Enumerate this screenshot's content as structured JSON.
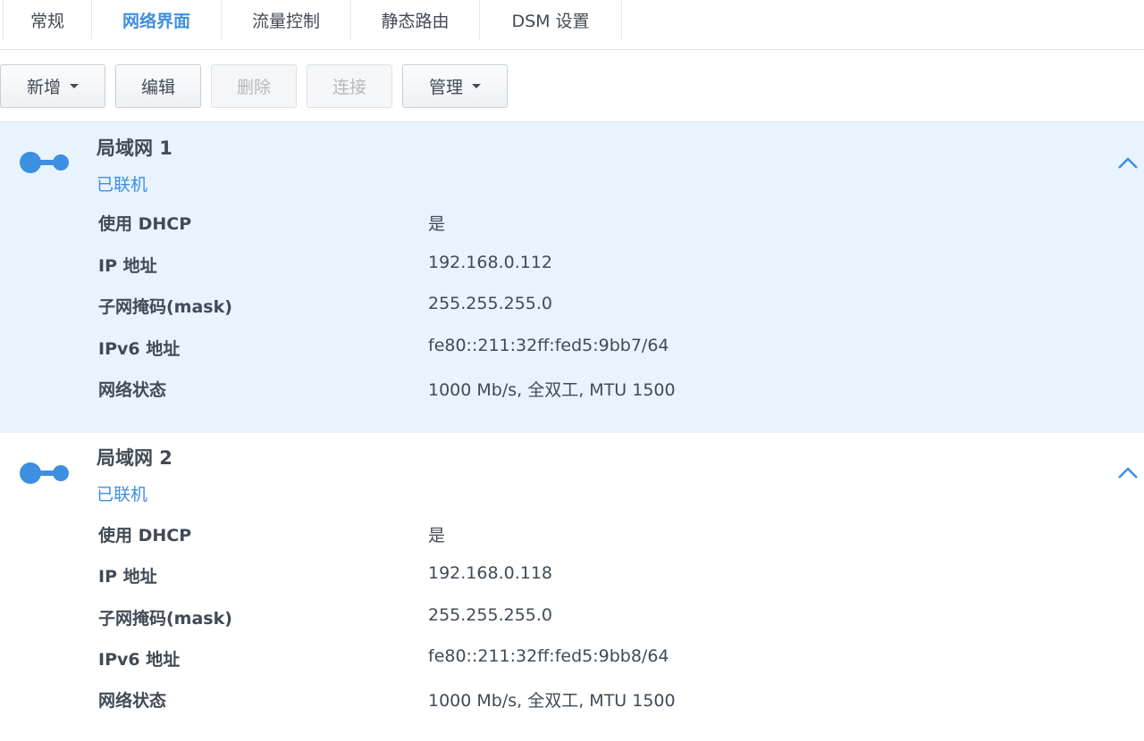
{
  "tabs": [
    {
      "label": "常规",
      "active": false
    },
    {
      "label": "网络界面",
      "active": true
    },
    {
      "label": "流量控制",
      "active": false
    },
    {
      "label": "静态路由",
      "active": false
    },
    {
      "label": "DSM 设置",
      "active": false
    }
  ],
  "toolbar": {
    "add_label": "新增",
    "edit_label": "编辑",
    "delete_label": "删除",
    "connect_label": "连接",
    "manage_label": "管理"
  },
  "interfaces": [
    {
      "name": "局域网 1",
      "status": "已联机",
      "selected": true,
      "rows": [
        {
          "label": "使用 DHCP",
          "value": "是"
        },
        {
          "label": "IP 地址",
          "value": "192.168.0.112"
        },
        {
          "label": "子网掩码(mask)",
          "value": "255.255.255.0"
        },
        {
          "label": "IPv6 地址",
          "value": "fe80::211:32ff:fed5:9bb7/64"
        },
        {
          "label": "网络状态",
          "value": "1000 Mb/s, 全双工, MTU 1500"
        }
      ]
    },
    {
      "name": "局域网 2",
      "status": "已联机",
      "selected": false,
      "rows": [
        {
          "label": "使用 DHCP",
          "value": "是"
        },
        {
          "label": "IP 地址",
          "value": "192.168.0.118"
        },
        {
          "label": "子网掩码(mask)",
          "value": "255.255.255.0"
        },
        {
          "label": "IPv6 地址",
          "value": "fe80::211:32ff:fed5:9bb8/64"
        },
        {
          "label": "网络状态",
          "value": "1000 Mb/s, 全双工, MTU 1500"
        }
      ]
    }
  ],
  "icons": {
    "interface": "network-connected-icon",
    "collapse": "chevron-up-icon",
    "dropdown": "caret-down-icon"
  },
  "colors": {
    "accent": "#3d8fe0",
    "text": "#414b55",
    "selected_bg": "#e8f3fd",
    "disabled_text": "#b3b9bf"
  }
}
